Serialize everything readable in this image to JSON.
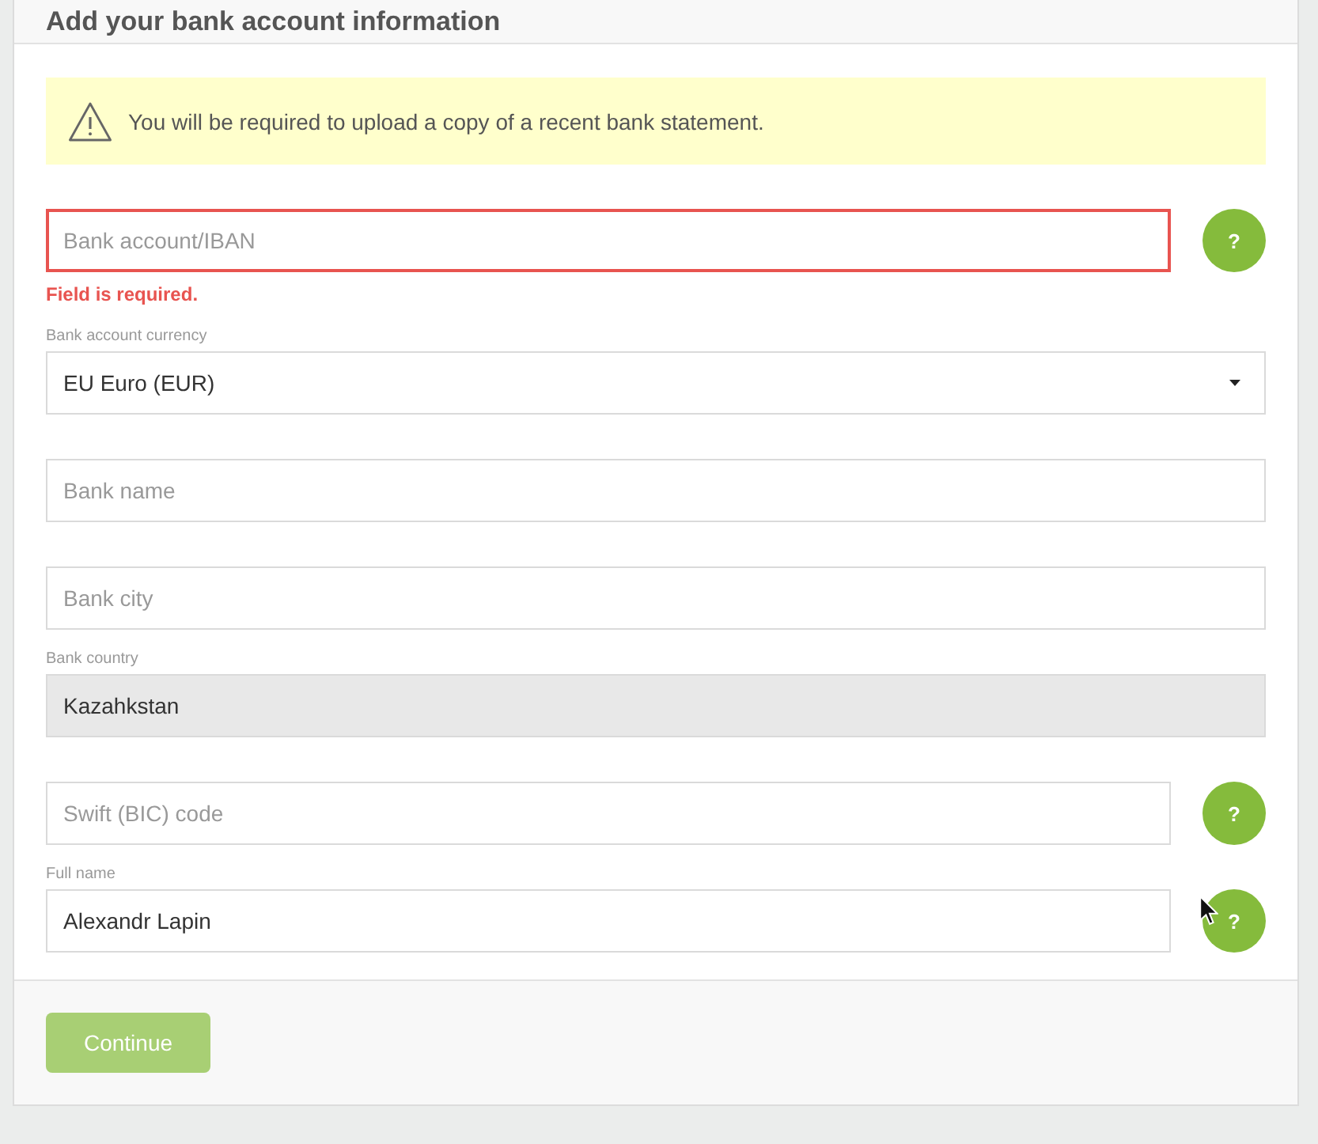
{
  "header": {
    "title": "Add your bank account information"
  },
  "notice": {
    "text": "You will be required to upload a copy of a recent bank statement."
  },
  "fields": [
    {
      "kind": "text",
      "placeholder": "Bank account/IBAN",
      "invalid": true,
      "disabled": false,
      "error": "Field is required.",
      "help": "?"
    },
    {
      "kind": "select",
      "label": "Bank account currency",
      "value": "EU Euro (EUR)",
      "invalid": false,
      "disabled": false
    },
    {
      "kind": "text",
      "placeholder": "Bank name",
      "invalid": false,
      "disabled": false
    },
    {
      "kind": "text",
      "placeholder": "Bank city",
      "invalid": false,
      "disabled": false
    },
    {
      "kind": "text",
      "label": "Bank country",
      "value": "Kazahkstan",
      "invalid": false,
      "disabled": true
    },
    {
      "kind": "text",
      "placeholder": "Swift (BIC) code",
      "invalid": false,
      "disabled": false,
      "help": "?"
    },
    {
      "kind": "text",
      "label": "Full name",
      "value": "Alexandr Lapin",
      "invalid": false,
      "disabled": false,
      "help": "?"
    }
  ],
  "footer": {
    "button": {
      "label": "Continue",
      "disabled": true
    }
  }
}
